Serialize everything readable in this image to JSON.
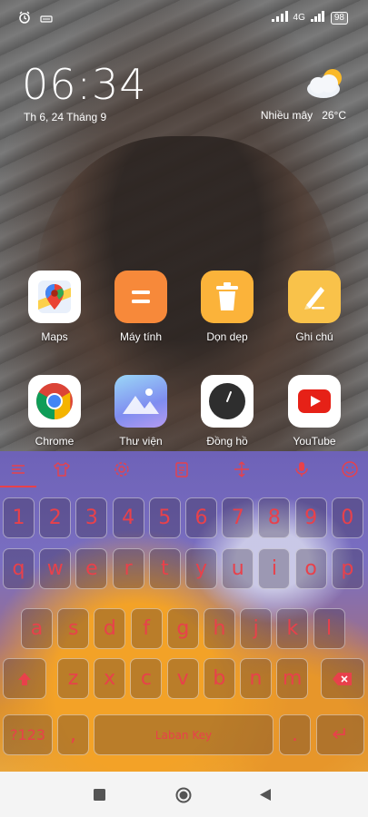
{
  "status_bar": {
    "network": "4G",
    "battery": "98"
  },
  "clock": {
    "time": "06:34",
    "date": "Th 6, 24 Tháng 9"
  },
  "weather": {
    "condition": "Nhiều mây",
    "temperature": "26°C"
  },
  "apps": [
    {
      "label": "Maps",
      "icon": "maps-icon"
    },
    {
      "label": "Máy tính",
      "icon": "calculator-icon"
    },
    {
      "label": "Dọn dẹp",
      "icon": "trash-icon"
    },
    {
      "label": "Ghi chú",
      "icon": "notes-icon"
    },
    {
      "label": "Chrome",
      "icon": "chrome-icon"
    },
    {
      "label": "Thư viện",
      "icon": "gallery-icon"
    },
    {
      "label": "Đồng hồ",
      "icon": "clock-icon"
    },
    {
      "label": "YouTube",
      "icon": "youtube-icon"
    }
  ],
  "keyboard": {
    "number_row": [
      "1",
      "2",
      "3",
      "4",
      "5",
      "6",
      "7",
      "8",
      "9",
      "0"
    ],
    "row1": [
      "q",
      "w",
      "e",
      "r",
      "t",
      "y",
      "u",
      "i",
      "o",
      "p"
    ],
    "row2": [
      "a",
      "s",
      "d",
      "f",
      "g",
      "h",
      "j",
      "k",
      "l"
    ],
    "row3": [
      "z",
      "x",
      "c",
      "v",
      "b",
      "n",
      "m"
    ],
    "symbols_key": "?123",
    "comma_key": ",",
    "space_label": "Laban Key",
    "period_key": ".",
    "enter_glyph": "↵",
    "key_color": "#e8414b"
  },
  "colors": {
    "maps_bg": "#ffffff",
    "calculator_bg": "#f7893a",
    "cleaner_bg": "#fbb33a",
    "notes_bg": "#f9c24a",
    "youtube_red": "#e62117"
  }
}
